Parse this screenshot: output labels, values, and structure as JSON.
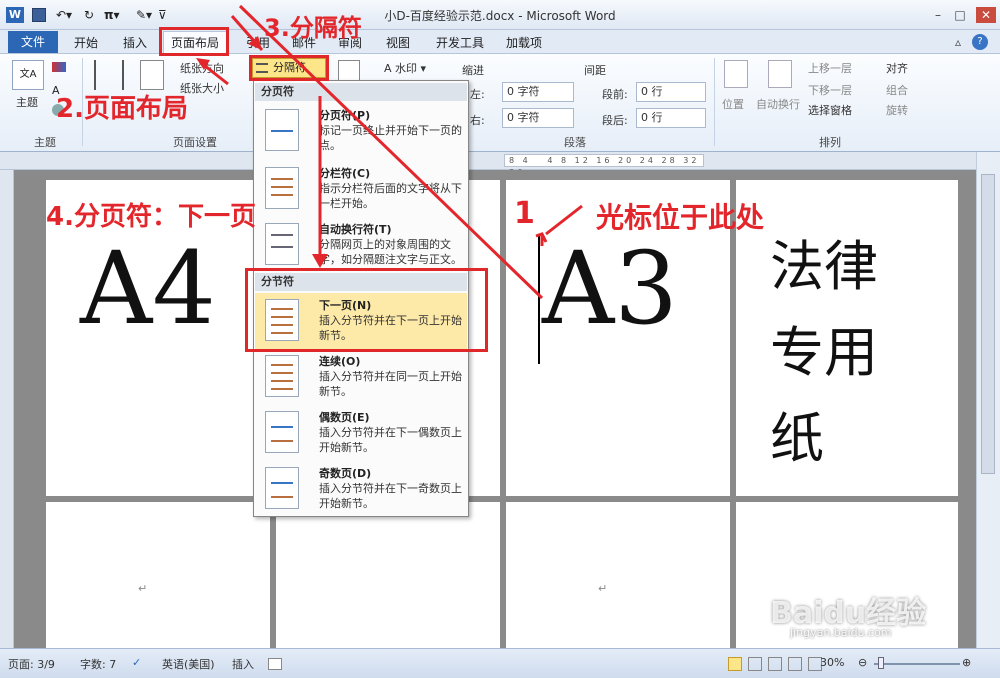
{
  "window": {
    "title": "小D-百度经验示范.docx  -  Microsoft Word",
    "app_icon": "W"
  },
  "tabs": [
    "文件",
    "开始",
    "插入",
    "页面布局",
    "引用",
    "邮件",
    "审阅",
    "视图",
    "开发工具",
    "加载项"
  ],
  "ribbon": {
    "theme_group": {
      "button": "主题",
      "label": "主题"
    },
    "page_setup": {
      "label": "页面设置",
      "direction": "纸张方向",
      "size": "纸张大小"
    },
    "breaks_button": "分隔符",
    "watermark": "水印",
    "indent": {
      "title": "缩进",
      "left_label": "左:",
      "right_label": "右:",
      "left_value": "0 字符",
      "right_value": "0 字符"
    },
    "spacing": {
      "title": "间距",
      "before_label": "段前:",
      "after_label": "段后:",
      "before_value": "0 行",
      "after_value": "0 行"
    },
    "paragraph_label": "段落",
    "arrange": {
      "label": "排列",
      "position": "位置",
      "wrap": "自动换行",
      "bring_forward": "上移一层",
      "send_backward": "下移一层",
      "selection_pane": "选择窗格",
      "align": "对齐",
      "group": "组合",
      "rotate": "旋转"
    }
  },
  "dropdown": {
    "section1": "分页符",
    "section2": "分节符",
    "items": [
      {
        "title": "分页符(P)",
        "desc": "标记一页终止并开始下一页的点。"
      },
      {
        "title": "分栏符(C)",
        "desc": "指示分栏符后面的文字将从下一栏开始。"
      },
      {
        "title": "自动换行符(T)",
        "desc": "分隔网页上的对象周围的文字，如分隔题注文字与正文。"
      },
      {
        "title": "下一页(N)",
        "desc": "插入分节符并在下一页上开始新节。"
      },
      {
        "title": "连续(O)",
        "desc": "插入分节符并在同一页上开始新节。"
      },
      {
        "title": "偶数页(E)",
        "desc": "插入分节符并在下一偶数页上开始新节。"
      },
      {
        "title": "奇数页(D)",
        "desc": "插入分节符并在下一奇数页上开始新节。"
      }
    ]
  },
  "document": {
    "page1_text": "A4",
    "page3_text": "A3",
    "page4_text": [
      "法律",
      "专用",
      "纸"
    ],
    "para_mark": "↵"
  },
  "annotations": {
    "step1": "1",
    "cursor_here": "光标位于此处",
    "step2": "2.页面布局",
    "step3": "3.分隔符",
    "step4": "4.分页符：下一页"
  },
  "status": {
    "page": "页面: 3/9",
    "words": "字数: 7",
    "language": "英语(美国)",
    "mode": "插入",
    "zoom": "30%"
  },
  "watermark": {
    "baidu": "Baidu经验",
    "url": "jingyan.baidu.com"
  },
  "colors": {
    "accent": "#2b67b5",
    "annotation": "#e3262b"
  }
}
